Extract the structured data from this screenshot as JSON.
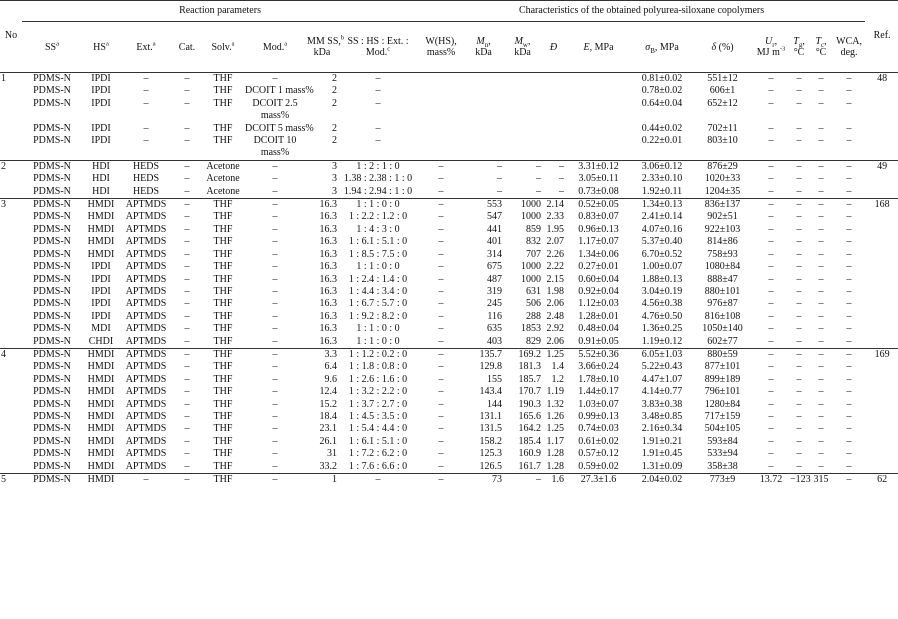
{
  "header": {
    "group_reaction": "Reaction parameters",
    "group_characteristics": "Characteristics of the obtained polyurea-siloxane copolymers",
    "no": "No",
    "ss": "SS",
    "hs": "HS",
    "ext": "Ext.",
    "cat": "Cat.",
    "solv": "Solv.",
    "mod": "Mod.",
    "mm_ss": "MM SS,",
    "mm_ss_unit": "kDa",
    "ratio": "SS : HS : Ext. : Mod.",
    "w_hs": "W(HS), mass%",
    "mn_sym": "M",
    "mn_sub": "n",
    "mn_unit": "kDa",
    "mw_sym": "M",
    "mw_sub": "w",
    "mw_unit": "kDa",
    "d_sym": "Đ",
    "e_sym": "E",
    "e_unit": ", MPa",
    "sigma_sym": "σ",
    "sigma_sub": "B",
    "sigma_unit": ", MPa",
    "delta_sym": "δ",
    "delta_unit": " (%)",
    "ur_sym": "U",
    "ur_sub": "r",
    "ur_unit": "MJ m",
    "ur_sup": "-3",
    "tg_sym": "T",
    "tg_sub": "g",
    "tg_unit": "°C",
    "tc_sym": "T",
    "tc_sub": "c",
    "tc_unit": "°C",
    "wca": "WCA,",
    "wca_unit": "deg.",
    "ref": "Ref.",
    "note_a": "a",
    "note_b": "b",
    "note_c": "c"
  },
  "groups": [
    {
      "no": "1",
      "ref": "48",
      "rows": [
        [
          "PDMS-N",
          "IPDI",
          "–",
          "–",
          "THF",
          "–",
          "2",
          "–",
          "",
          "",
          "",
          "",
          "",
          "0.81±0.02",
          "551±12",
          "–",
          "–",
          "–",
          "–"
        ],
        [
          "PDMS-N",
          "IPDI",
          "–",
          "–",
          "THF",
          "DCOIT 1 mass%",
          "2",
          "–",
          "",
          "",
          "",
          "",
          "",
          "0.78±0.02",
          "606±1",
          "–",
          "–",
          "–",
          "–"
        ],
        [
          "PDMS-N",
          "IPDI",
          "–",
          "–",
          "THF",
          "DCOIT 2.5 mass%",
          "2",
          "–",
          "",
          "",
          "",
          "",
          "",
          "0.64±0.04",
          "652±12",
          "–",
          "–",
          "–",
          "–"
        ],
        [
          "PDMS-N",
          "IPDI",
          "–",
          "–",
          "THF",
          "DCOIT 5 mass%",
          "2",
          "–",
          "",
          "",
          "",
          "",
          "",
          "0.44±0.02",
          "702±11",
          "–",
          "–",
          "–",
          "–"
        ],
        [
          "PDMS-N",
          "IPDI",
          "–",
          "–",
          "THF",
          "DCOIT 10 mass%",
          "2",
          "–",
          "",
          "",
          "",
          "",
          "",
          "0.22±0.01",
          "803±10",
          "–",
          "–",
          "–",
          "–"
        ]
      ]
    },
    {
      "no": "2",
      "ref": "49",
      "rows": [
        [
          "PDMS-N",
          "HDI",
          "HEDS",
          "–",
          "Acetone",
          "–",
          "3",
          "1 : 2 : 1 : 0",
          "–",
          "–",
          "–",
          "–",
          "3.31±0.12",
          "3.06±0.12",
          "876±29",
          "–",
          "–",
          "–",
          "–"
        ],
        [
          "PDMS-N",
          "HDI",
          "HEDS",
          "–",
          "Acetone",
          "–",
          "3",
          "1.38 : 2.38 : 1 : 0",
          "–",
          "–",
          "–",
          "–",
          "3.05±0.11",
          "2.33±0.10",
          "1020±33",
          "–",
          "–",
          "–",
          "–"
        ],
        [
          "PDMS-N",
          "HDI",
          "HEDS",
          "–",
          "Acetone",
          "–",
          "3",
          "1.94 : 2.94 : 1 : 0",
          "–",
          "–",
          "–",
          "–",
          "0.73±0.08",
          "1.92±0.11",
          "1204±35",
          "–",
          "–",
          "–",
          "–"
        ]
      ]
    },
    {
      "no": "3",
      "ref": "168",
      "rows": [
        [
          "PDMS-N",
          "HMDI",
          "APTMDS",
          "–",
          "THF",
          "–",
          "16.3",
          "1 : 1 : 0 : 0",
          "–",
          "553",
          "1000",
          "2.14",
          "0.52±0.05",
          "1.34±0.13",
          "836±137",
          "–",
          "–",
          "–",
          "–"
        ],
        [
          "PDMS-N",
          "HMDI",
          "APTMDS",
          "–",
          "THF",
          "–",
          "16.3",
          "1 : 2.2 : 1.2 : 0",
          "–",
          "547",
          "1000",
          "2.33",
          "0.83±0.07",
          "2.41±0.14",
          "902±51",
          "–",
          "–",
          "–",
          "–"
        ],
        [
          "PDMS-N",
          "HMDI",
          "APTMDS",
          "–",
          "THF",
          "–",
          "16.3",
          "1 : 4 : 3 : 0",
          "–",
          "441",
          "859",
          "1.95",
          "0.96±0.13",
          "4.07±0.16",
          "922±103",
          "–",
          "–",
          "–",
          "–"
        ],
        [
          "PDMS-N",
          "HMDI",
          "APTMDS",
          "–",
          "THF",
          "–",
          "16.3",
          "1 : 6.1 : 5.1 : 0",
          "–",
          "401",
          "832",
          "2.07",
          "1.17±0.07",
          "5.37±0.40",
          "814±86",
          "–",
          "–",
          "–",
          "–"
        ],
        [
          "PDMS-N",
          "HMDI",
          "APTMDS",
          "–",
          "THF",
          "–",
          "16.3",
          "1 : 8.5 : 7.5 : 0",
          "–",
          "314",
          "707",
          "2.26",
          "1.34±0.06",
          "6.70±0.52",
          "758±93",
          "–",
          "–",
          "–",
          "–"
        ],
        [
          "PDMS-N",
          "IPDI",
          "APTMDS",
          "–",
          "THF",
          "–",
          "16.3",
          "1 : 1 : 0 : 0",
          "–",
          "675",
          "1000",
          "2.22",
          "0.27±0.01",
          "1.00±0.07",
          "1080±84",
          "–",
          "–",
          "–",
          "–"
        ],
        [
          "PDMS-N",
          "IPDI",
          "APTMDS",
          "–",
          "THF",
          "–",
          "16.3",
          "1 : 2.4 : 1.4 : 0",
          "–",
          "487",
          "1000",
          "2.15",
          "0.60±0.04",
          "1.88±0.13",
          "888±47",
          "–",
          "–",
          "–",
          "–"
        ],
        [
          "PDMS-N",
          "IPDI",
          "APTMDS",
          "–",
          "THF",
          "–",
          "16.3",
          "1 : 4.4 : 3.4 : 0",
          "–",
          "319",
          "631",
          "1.98",
          "0.92±0.04",
          "3.04±0.19",
          "880±101",
          "–",
          "–",
          "–",
          "–"
        ],
        [
          "PDMS-N",
          "IPDI",
          "APTMDS",
          "–",
          "THF",
          "–",
          "16.3",
          "1 : 6.7 : 5.7 : 0",
          "–",
          "245",
          "506",
          "2.06",
          "1.12±0.03",
          "4.56±0.38",
          "976±87",
          "–",
          "–",
          "–",
          "–"
        ],
        [
          "PDMS-N",
          "IPDI",
          "APTMDS",
          "–",
          "THF",
          "–",
          "16.3",
          "1 : 9.2 : 8.2 : 0",
          "–",
          "116",
          "288",
          "2.48",
          "1.28±0.01",
          "4.76±0.50",
          "816±108",
          "–",
          "–",
          "–",
          "–"
        ],
        [
          "PDMS-N",
          "MDI",
          "APTMDS",
          "–",
          "THF",
          "–",
          "16.3",
          "1 : 1 : 0 : 0",
          "–",
          "635",
          "1853",
          "2.92",
          "0.48±0.04",
          "1.36±0.25",
          "1050±140",
          "–",
          "–",
          "–",
          "–"
        ],
        [
          "PDMS-N",
          "CHDI",
          "APTMDS",
          "–",
          "THF",
          "–",
          "16.3",
          "1 : 1 : 0 : 0",
          "–",
          "403",
          "829",
          "2.06",
          "0.91±0.05",
          "1.19±0.12",
          "602±77",
          "–",
          "–",
          "–",
          "–"
        ]
      ]
    },
    {
      "no": "4",
      "ref": "169",
      "rows": [
        [
          "PDMS-N",
          "HMDI",
          "APTMDS",
          "–",
          "THF",
          "–",
          "3.3",
          "1 : 1.2 : 0.2 : 0",
          "–",
          "135.7",
          "169.2",
          "1.25",
          "5.52±0.36",
          "6.05±1.03",
          "880±59",
          "–",
          "–",
          "–",
          "–"
        ],
        [
          "PDMS-N",
          "HMDI",
          "APTMDS",
          "–",
          "THF",
          "–",
          "6.4",
          "1 : 1.8 : 0.8 : 0",
          "–",
          "129.8",
          "181.3",
          "1.4",
          "3.66±0.24",
          "5.22±0.43",
          "877±101",
          "–",
          "–",
          "–",
          "–"
        ],
        [
          "PDMS-N",
          "HMDI",
          "APTMDS",
          "–",
          "THF",
          "–",
          "9.6",
          "1 : 2.6 : 1.6 : 0",
          "–",
          "155",
          "185.7",
          "1.2",
          "1.78±0.10",
          "4.47±1.07",
          "899±189",
          "–",
          "–",
          "–",
          "–"
        ],
        [
          "PDMS-N",
          "HMDI",
          "APTMDS",
          "–",
          "THF",
          "–",
          "12.4",
          "1 : 3.2 : 2.2 : 0",
          "–",
          "143.4",
          "170.7",
          "1.19",
          "1.44±0.17",
          "4.14±0.77",
          "796±101",
          "–",
          "–",
          "–",
          "–"
        ],
        [
          "PDMS-N",
          "HMDI",
          "APTMDS",
          "–",
          "THF",
          "–",
          "15.2",
          "1 : 3.7 : 2.7 : 0",
          "–",
          "144",
          "190.3",
          "1.32",
          "1.03±0.07",
          "3.83±0.38",
          "1280±84",
          "–",
          "–",
          "–",
          "–"
        ],
        [
          "PDMS-N",
          "HMDI",
          "APTMDS",
          "–",
          "THF",
          "–",
          "18.4",
          "1 : 4.5 : 3.5 : 0",
          "–",
          "131.1",
          "165.6",
          "1.26",
          "0.99±0.13",
          "3.48±0.85",
          "717±159",
          "–",
          "–",
          "–",
          "–"
        ],
        [
          "PDMS-N",
          "HMDI",
          "APTMDS",
          "–",
          "THF",
          "–",
          "23.1",
          "1 : 5.4 : 4.4 : 0",
          "–",
          "131.5",
          "164.2",
          "1.25",
          "0.74±0.03",
          "2.16±0.34",
          "504±105",
          "–",
          "–",
          "–",
          "–"
        ],
        [
          "PDMS-N",
          "HMDI",
          "APTMDS",
          "–",
          "THF",
          "–",
          "26.1",
          "1 : 6.1 : 5.1 : 0",
          "–",
          "158.2",
          "185.4",
          "1.17",
          "0.61±0.02",
          "1.91±0.21",
          "593±84",
          "–",
          "–",
          "–",
          "–"
        ],
        [
          "PDMS-N",
          "HMDI",
          "APTMDS",
          "–",
          "THF",
          "–",
          "31",
          "1 : 7.2 : 6.2 : 0",
          "–",
          "125.3",
          "160.9",
          "1.28",
          "0.57±0.12",
          "1.91±0.45",
          "533±94",
          "–",
          "–",
          "–",
          "–"
        ],
        [
          "PDMS-N",
          "HMDI",
          "APTMDS",
          "–",
          "THF",
          "–",
          "33.2",
          "1 : 7.6 : 6.6 : 0",
          "–",
          "126.5",
          "161.7",
          "1.28",
          "0.59±0.02",
          "1.31±0.09",
          "358±38",
          "–",
          "–",
          "–",
          "–"
        ]
      ]
    },
    {
      "no": "5",
      "ref": "62",
      "rows": [
        [
          "PDMS-N",
          "HMDI",
          "–",
          "–",
          "THF",
          "–",
          "1",
          "–",
          "–",
          "73",
          "–",
          "1.6",
          "27.3±1.6",
          "2.04±0.02",
          "773±9",
          "13.72",
          "−123",
          "315",
          "–"
        ]
      ]
    }
  ]
}
